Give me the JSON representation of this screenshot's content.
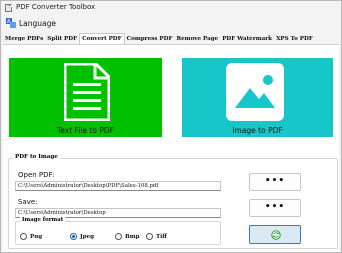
{
  "window": {
    "title": "PDF Converter Toolbox"
  },
  "menu": {
    "language": "Language"
  },
  "tabs": [
    {
      "label": "Merge PDFs"
    },
    {
      "label": "Split PDF"
    },
    {
      "label": "Convert PDF"
    },
    {
      "label": "Compress PDF"
    },
    {
      "label": "Remove Page"
    },
    {
      "label": "PDF Watermark"
    },
    {
      "label": "XPS To PDF"
    }
  ],
  "active_tab": "Convert PDF",
  "tiles": {
    "text_to_pdf": {
      "label": "Text File to PDF",
      "icon": "document-icon",
      "color": "#00c000"
    },
    "image_to_pdf": {
      "label": "Image to PDF",
      "icon": "image-icon",
      "color": "#16c6c8"
    }
  },
  "group": {
    "title": "PDF to Image",
    "open_label": "Open PDF:",
    "open_value": "C:\\Users\\Administrator\\Desktop\\PDF\\Sales-108.pdf",
    "save_label": "Save:",
    "save_value": "C:\\Users\\Administrator\\Desktop",
    "browse_label": "•••",
    "format_title": "Image format",
    "formats": [
      {
        "label": "Png",
        "checked": false
      },
      {
        "label": "Jpeg",
        "checked": true
      },
      {
        "label": "Bmp",
        "checked": false
      },
      {
        "label": "Tiff",
        "checked": false
      }
    ],
    "convert_icon": "refresh-icon"
  }
}
